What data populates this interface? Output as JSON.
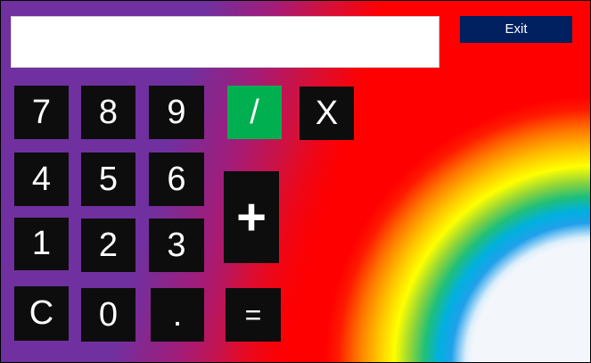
{
  "display": {
    "value": ""
  },
  "exit": {
    "label": "Exit"
  },
  "keys": {
    "k7": "7",
    "k8": "8",
    "k9": "9",
    "k4": "4",
    "k5": "5",
    "k6": "6",
    "k1": "1",
    "k2": "2",
    "k3": "3",
    "clear": "C",
    "k0": "0",
    "dot": ".",
    "divide": "/",
    "multiply": "X",
    "plus": "+",
    "equals": "="
  },
  "colors": {
    "key_bg": "#0d0d0d",
    "divide_bg": "#00b050",
    "exit_bg": "#002060",
    "background_left": "#7030a0",
    "background_right": "#ff0000"
  }
}
